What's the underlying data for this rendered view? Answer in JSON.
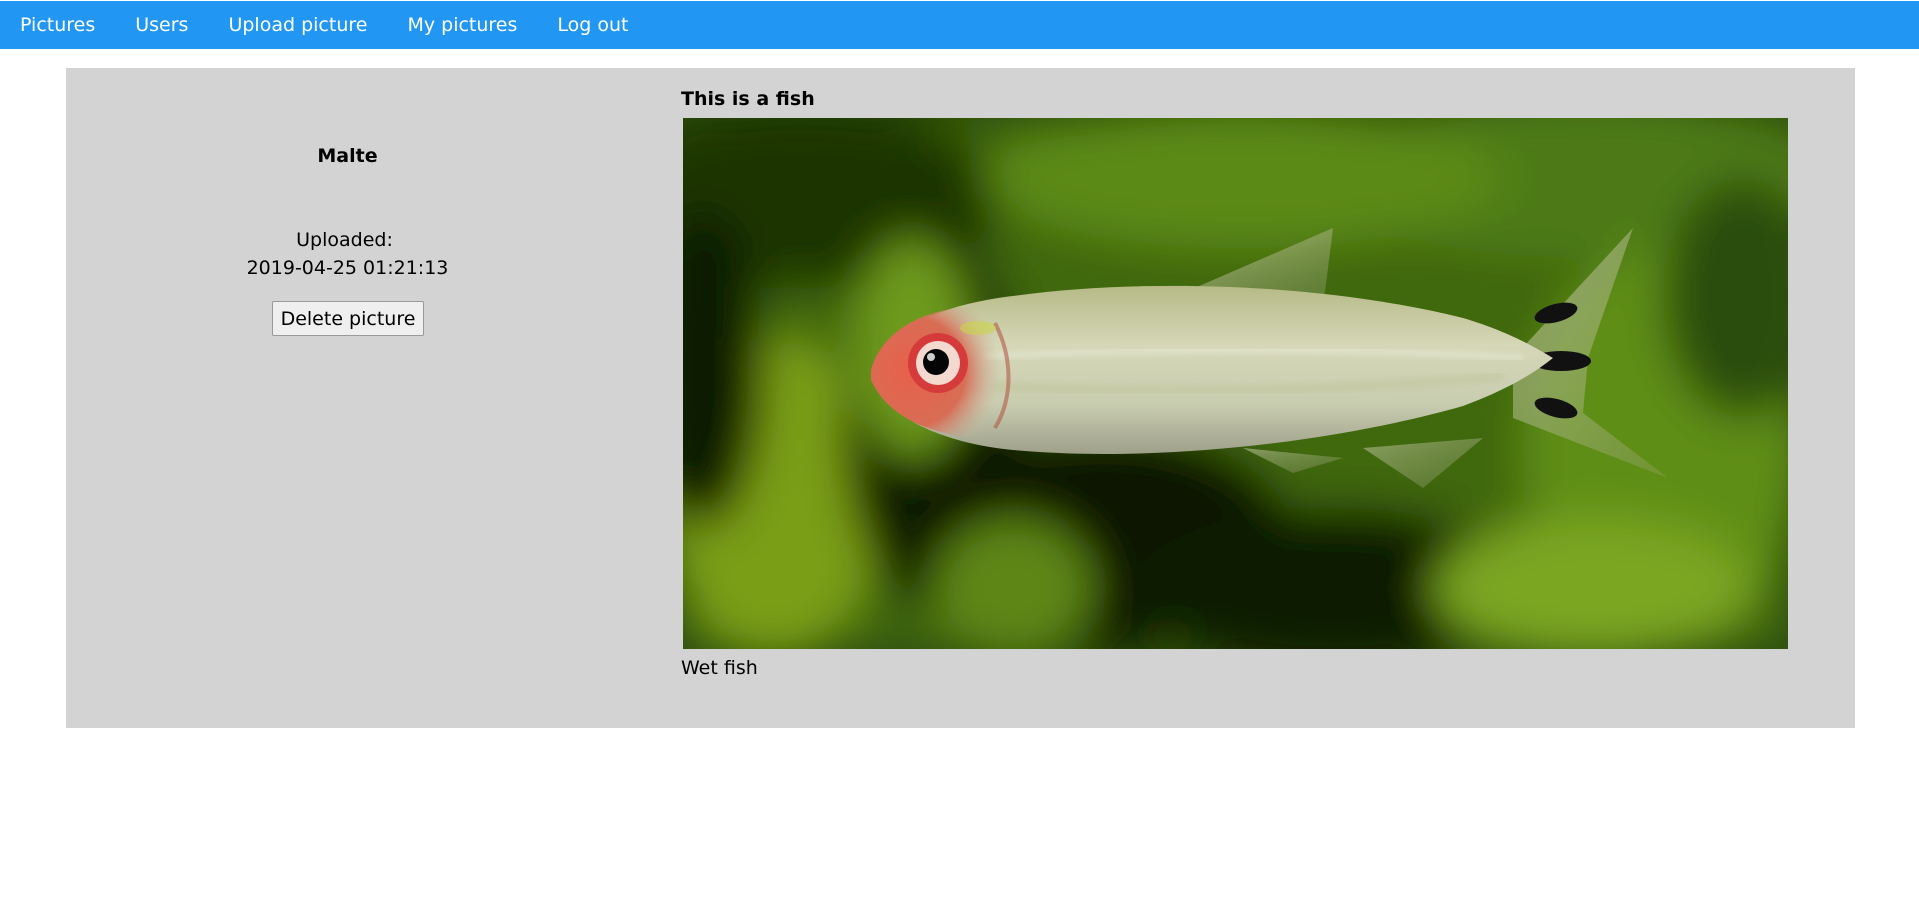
{
  "nav": {
    "items": [
      {
        "label": "Pictures"
      },
      {
        "label": "Users"
      },
      {
        "label": "Upload picture"
      },
      {
        "label": "My pictures"
      },
      {
        "label": "Log out"
      }
    ]
  },
  "picture": {
    "uploader": "Malte",
    "uploaded_label": "Uploaded:",
    "uploaded_at": "2019-04-25 01:21:13",
    "delete_label": "Delete picture",
    "title": "This is a fish",
    "description": "Wet fish"
  },
  "colors": {
    "nav_bg": "#2196f3",
    "card_bg": "#d3d3d3"
  }
}
